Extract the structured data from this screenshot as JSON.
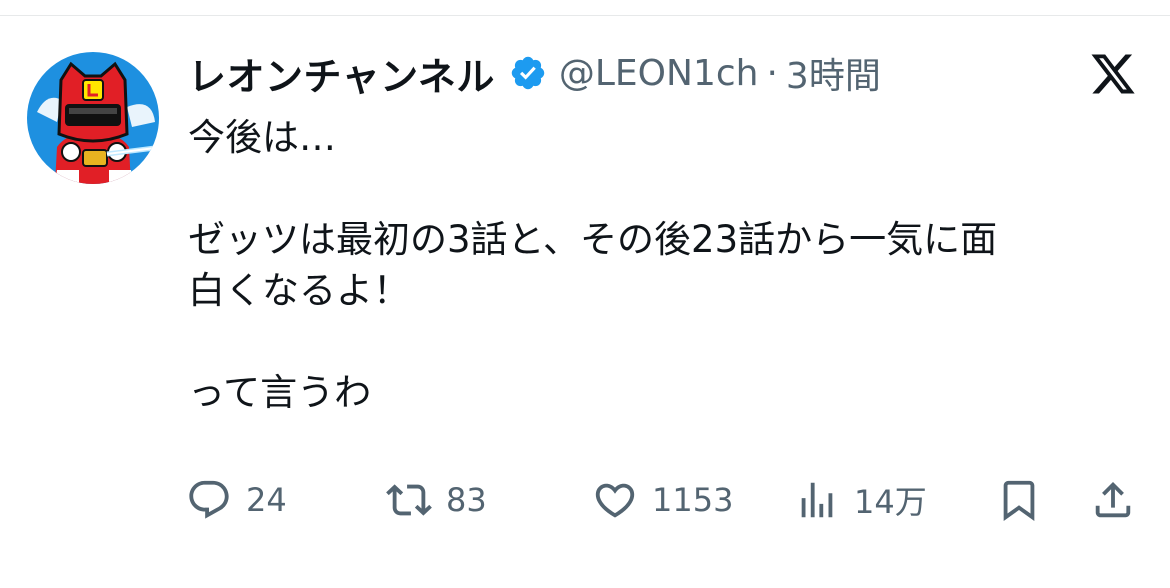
{
  "tweet": {
    "display_name": "レオンチャンネル",
    "handle": "@LEON1ch",
    "separator": "·",
    "time": "3時間",
    "lines": [
      "今後は…",
      "",
      "ゼッツは最初の3話と、その後23話から一気に面",
      "白くなるよ！",
      "",
      "って言うわ"
    ]
  },
  "icons": {
    "verified": "verified-badge-icon",
    "logo": "x-logo-icon",
    "reply": "reply-icon",
    "retweet": "retweet-icon",
    "like": "heart-icon",
    "views": "views-icon",
    "bookmark": "bookmark-icon",
    "share": "share-icon"
  },
  "actions": {
    "reply_count": "24",
    "retweet_count": "83",
    "like_count": "1153",
    "views_count": "14万"
  },
  "colors": {
    "text": "#0f1419",
    "secondary": "#536471",
    "verified": "#1d9bf0",
    "avatar_bg": "#1e90e0",
    "avatar_red": "#e11f26"
  }
}
